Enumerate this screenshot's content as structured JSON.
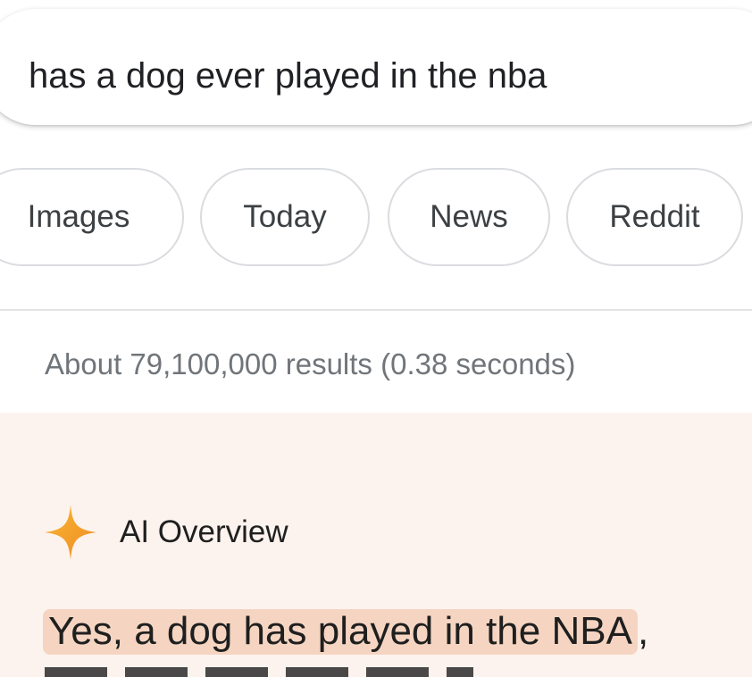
{
  "search": {
    "query": "has a dog ever played in the nba"
  },
  "chips": [
    {
      "label": "Images"
    },
    {
      "label": "Today"
    },
    {
      "label": "News"
    },
    {
      "label": "Reddit"
    }
  ],
  "results": {
    "stats": "About 79,100,000 results (0.38 seconds)"
  },
  "ai_overview": {
    "title": "AI Overview",
    "icon": "sparkle-icon",
    "answer": "Yes, a dog has played in the NBA",
    "answer_trailing": ","
  },
  "colors": {
    "panel_background": "#fdf3ee",
    "highlight": "#f5d5c2",
    "sparkle": "#f5a623"
  }
}
